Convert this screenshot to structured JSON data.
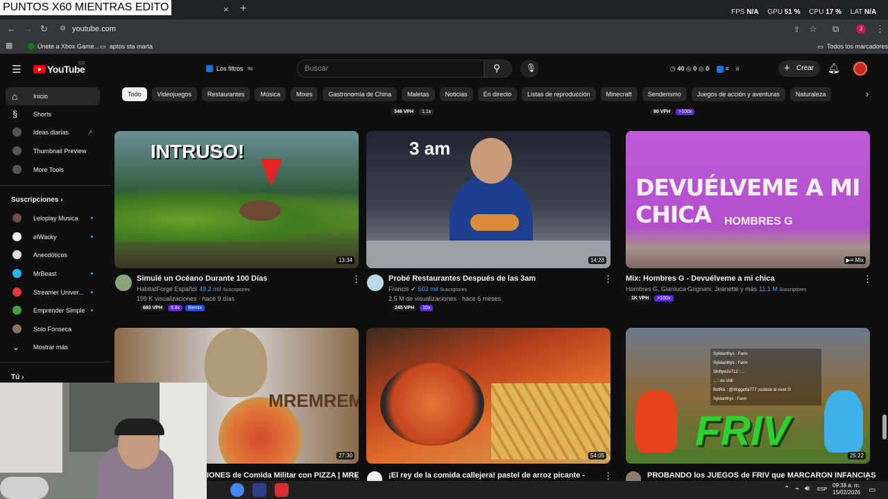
{
  "stream_overlay": {
    "title": "PUNTOS X60 MIENTRAS EDITO"
  },
  "browser": {
    "tab_close": "×",
    "tab_add": "+",
    "url": "youtube.com",
    "bookmarks": [
      "Únete a Xbox Game...",
      "aptos sta marta"
    ],
    "all_bookmarks": "Todos los marcadores",
    "profile_initial": "J"
  },
  "perf_stats": [
    {
      "label": "FPS",
      "value": "N/A"
    },
    {
      "label": "GPU",
      "value": "51 %"
    },
    {
      "label": "CPU",
      "value": "17 %"
    },
    {
      "label": "LAT",
      "value": "N/A"
    }
  ],
  "youtube": {
    "logo": "YouTube",
    "country": "CO",
    "filters_label": "Los filtros",
    "search_placeholder": "Buscar",
    "header_counts": [
      "40",
      "0",
      "0"
    ],
    "create_label": "Crear"
  },
  "sidebar": {
    "main": [
      "Inicio",
      "Shorts",
      "Ideas diarias",
      "Thumbnail Preview",
      "More Tools"
    ],
    "subscriptions_title": "Suscripciones",
    "subscriptions": [
      "Leloplay Musica",
      "elWacky",
      "Anecdóticos",
      "MrBeast",
      "Streamer Univer...",
      "Emprender Simple",
      "Solo Fonseca"
    ],
    "show_more": "Mostrar más",
    "you_title": "Tú"
  },
  "chips": [
    "Todo",
    "Videojuegos",
    "Restaurantes",
    "Música",
    "Mixes",
    "Gastronomía de China",
    "Maletas",
    "Noticias",
    "En directo",
    "Listas de reproducción",
    "Minecraft",
    "Senderismo",
    "Juegos de acción y aventuras",
    "Naturaleza"
  ],
  "top_tags": [
    {
      "vph": "346 VPH",
      "mult": "1.1x"
    },
    {
      "vph": "90 VPH",
      "mult": ">100x"
    }
  ],
  "videos_row1": [
    {
      "title": "Simulé un Océano Durante 100 Días",
      "channel": "HabitatForge Español",
      "subs": "49.2 mil",
      "subs_label": "Suscriptores",
      "meta": "199 K visualizaciones · hace 9 días",
      "duration": "13:34",
      "vph": "693 VPH",
      "mult": "9.8x",
      "extra": "Remix",
      "thumb_text": "INTRUSO!"
    },
    {
      "title": "Probé Restaurantes Después de las 3am",
      "channel": "Francis",
      "subs": "503 mil",
      "subs_label": "Suscriptores",
      "meta": "2,5 M de visualizaciones · hace 6 meses",
      "duration": "14:23",
      "vph": "245 VPH",
      "mult": "10x",
      "thumb_text": "3 am"
    },
    {
      "title": "Mix: Hombres G - Devuélveme a mi chica",
      "channel": "Hombres G, Gianluca Grignani, Jeanette y más",
      "subs": "11.1 M",
      "subs_label": "Suscriptores",
      "duration": "Mix",
      "vph": "1K VPH",
      "mult": ">100x",
      "thumb_text": "DEVUÉLVEME A MI CHICA",
      "thumb_sub": "HOMBRES G"
    }
  ],
  "videos_row2": [
    {
      "title": "IONES de Comida Militar con PIZZA | MRE",
      "duration": "27:30",
      "thumb_text": "MREMREM"
    },
    {
      "title": "¡El rey de la comida callejera! pastel de arroz picante -",
      "duration": "54:05"
    },
    {
      "title": "PROBANDO los JUEGOS de FRIV que MARCARON INFANCIAS",
      "duration": "25:22",
      "thumb_text": "FRIV"
    }
  ],
  "chat_overlay": [
    "Sylidanthys : Farm",
    "Sylidanthys : Farm",
    "Shiftyw2v712 : ...",
    "... : de chill",
    "BotRix : @Wiggetta777 ¡subiste al nivel 3!",
    "Syldanthys : Farm"
  ],
  "taskbar": {
    "lang": "ESP",
    "time": "09:38 a. m.",
    "date": "15/02/2026"
  },
  "colors": {
    "accent_red": "#ff0000",
    "link_blue": "#3ea6ff",
    "badge_purple": "#5b2bd8"
  }
}
